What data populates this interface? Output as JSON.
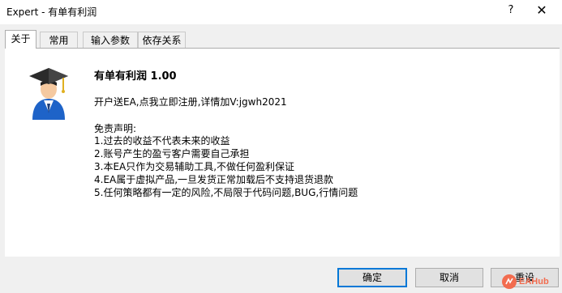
{
  "window": {
    "title": "Expert - 有单有利润",
    "help_glyph": "?",
    "close_glyph": "✕"
  },
  "tabs": [
    {
      "label": "关于",
      "active": true
    },
    {
      "label": "常用",
      "active": false
    },
    {
      "label": "输入参数",
      "active": false
    },
    {
      "label": "依存关系",
      "active": false
    }
  ],
  "about": {
    "icon": "graduate-user-icon",
    "product_title": "有单有利润 1.00",
    "promo": "开户送EA,点我立即注册,详情加V:jgwh2021",
    "disclaimer_title": "免责声明:",
    "disclaimer_lines": [
      "1.过去的收益不代表未来的收益",
      "2.账号产生的盈亏客户需要自己承担",
      "3.本EA只作为交易辅助工具,不做任何盈利保证",
      "4.EA属于虚拟产品,一旦发货正常加载后不支持退货退款",
      "5.任何策略都有一定的风险,不局限于代码问题,BUG,行情问题"
    ]
  },
  "buttons": {
    "ok": "确定",
    "cancel": "取消",
    "reset": "重设"
  },
  "watermark": {
    "text": "EAHub",
    "color": "#f26c4f"
  },
  "colors": {
    "accent": "#0078d7"
  }
}
